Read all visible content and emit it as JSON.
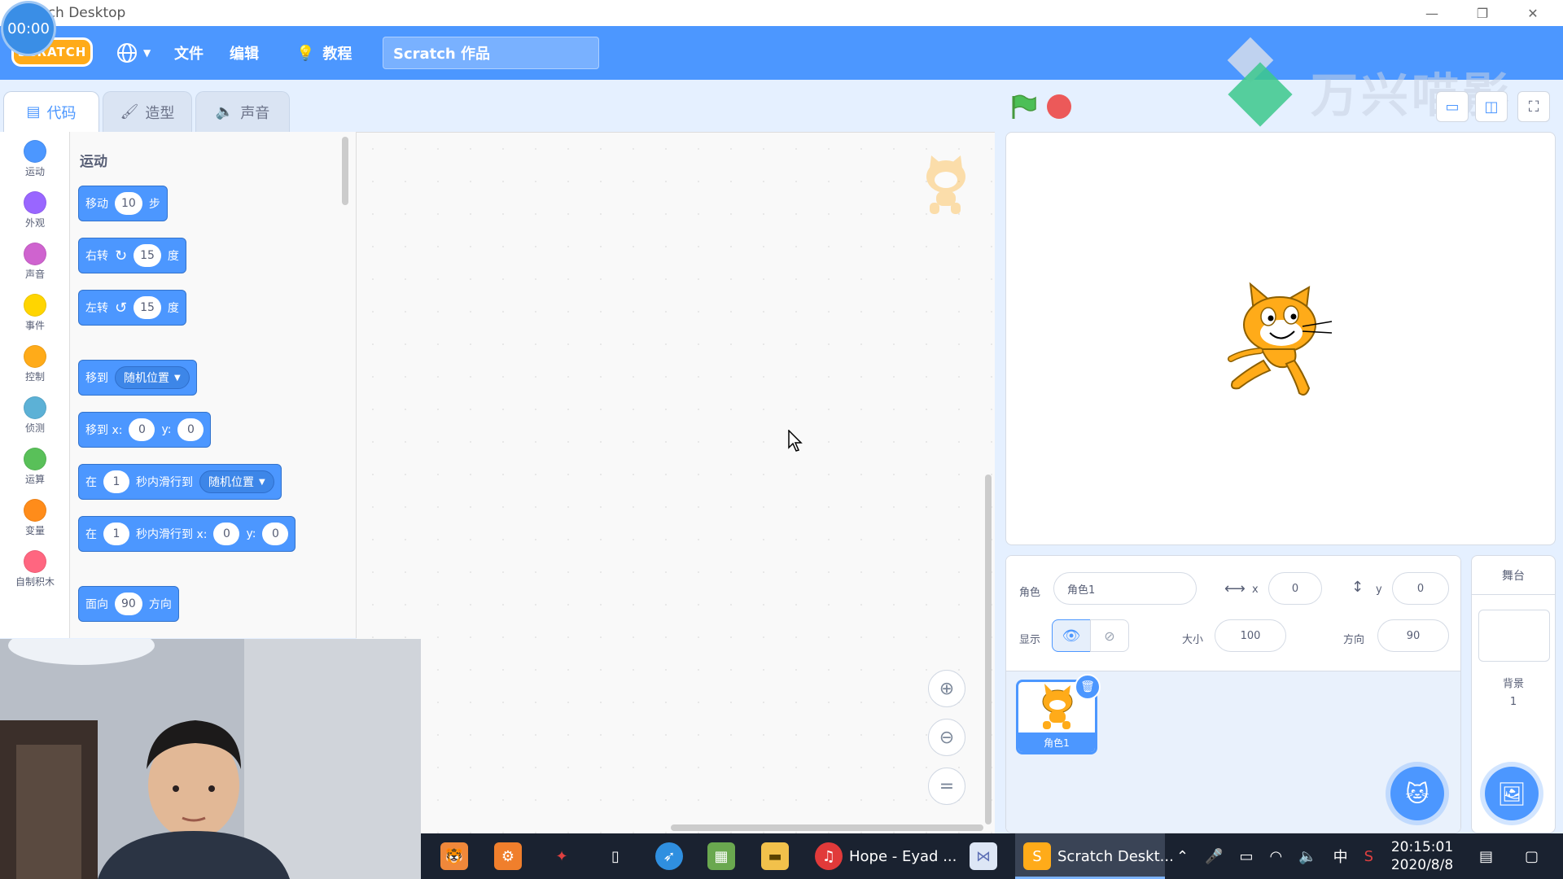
{
  "window": {
    "title": "tch Desktop",
    "timer": "00:00",
    "controls": [
      "—",
      "❐",
      "✕"
    ]
  },
  "menubar": {
    "logo": "SCRATCH",
    "items": [
      "文件",
      "编辑",
      "教程"
    ],
    "project_title": "Scratch 作品",
    "accent": "#4c97ff"
  },
  "watermark": {
    "text": "万兴喵影"
  },
  "tabs": [
    {
      "label": "代码",
      "icon": "code-icon"
    },
    {
      "label": "造型",
      "icon": "brush-icon"
    },
    {
      "label": "声音",
      "icon": "speaker-icon"
    }
  ],
  "categories": [
    {
      "label": "运动",
      "color": "#4c97ff"
    },
    {
      "label": "外观",
      "color": "#9966ff"
    },
    {
      "label": "声音",
      "color": "#cf63cf"
    },
    {
      "label": "事件",
      "color": "#ffd500"
    },
    {
      "label": "控制",
      "color": "#ffab19"
    },
    {
      "label": "侦测",
      "color": "#5cb1d6"
    },
    {
      "label": "运算",
      "color": "#59c059"
    },
    {
      "label": "变量",
      "color": "#ff8c1a"
    },
    {
      "label": "自制积木",
      "color": "#ff6680"
    }
  ],
  "palette": {
    "title": "运动",
    "blocks": {
      "move": {
        "label": "移动",
        "value": "10",
        "suffix": "步"
      },
      "turn_right": {
        "label": "右转",
        "value": "15",
        "suffix": "度"
      },
      "turn_left": {
        "label": "左转",
        "value": "15",
        "suffix": "度"
      },
      "goto": {
        "label": "移到",
        "option": "随机位置"
      },
      "goto_xy": {
        "label": "移到 x:",
        "x": "0",
        "y_label": "y:",
        "y": "0"
      },
      "glide": {
        "label": "在",
        "secs": "1",
        "mid": "秒内滑行到",
        "option": "随机位置"
      },
      "glide_xy": {
        "label": "在",
        "secs": "1",
        "mid": "秒内滑行到 x:",
        "x": "0",
        "y_label": "y:",
        "y": "0"
      },
      "point": {
        "label": "面向",
        "value": "90",
        "suffix": "方向"
      }
    }
  },
  "sprite_info": {
    "sprite_label": "角色",
    "sprite_name": "角色1",
    "x_label": "x",
    "x": "0",
    "y_label": "y",
    "y": "0",
    "show_label": "显示",
    "size_label": "大小",
    "size": "100",
    "direction_label": "方向",
    "direction": "90"
  },
  "sprites": [
    {
      "name": "角色1"
    }
  ],
  "stage_pane": {
    "title": "舞台",
    "backdrop_label": "背景",
    "backdrop_count": "1"
  },
  "taskbar": {
    "apps": [
      {
        "name": "",
        "icon": "app-icon-1"
      },
      {
        "name": "",
        "icon": "settings-app-icon"
      },
      {
        "name": "",
        "icon": "game-app-icon"
      },
      {
        "name": "",
        "icon": "file-app-icon"
      },
      {
        "name": "",
        "icon": "feather-app-icon"
      },
      {
        "name": "",
        "icon": "minecraft-app-icon"
      },
      {
        "name": "",
        "icon": "folder-app-icon"
      }
    ],
    "music": "Hope - Eyad ...",
    "scratch": "Scratch Deskt...",
    "ime": "中",
    "time": "20:15:01",
    "date": "2020/8/8"
  }
}
